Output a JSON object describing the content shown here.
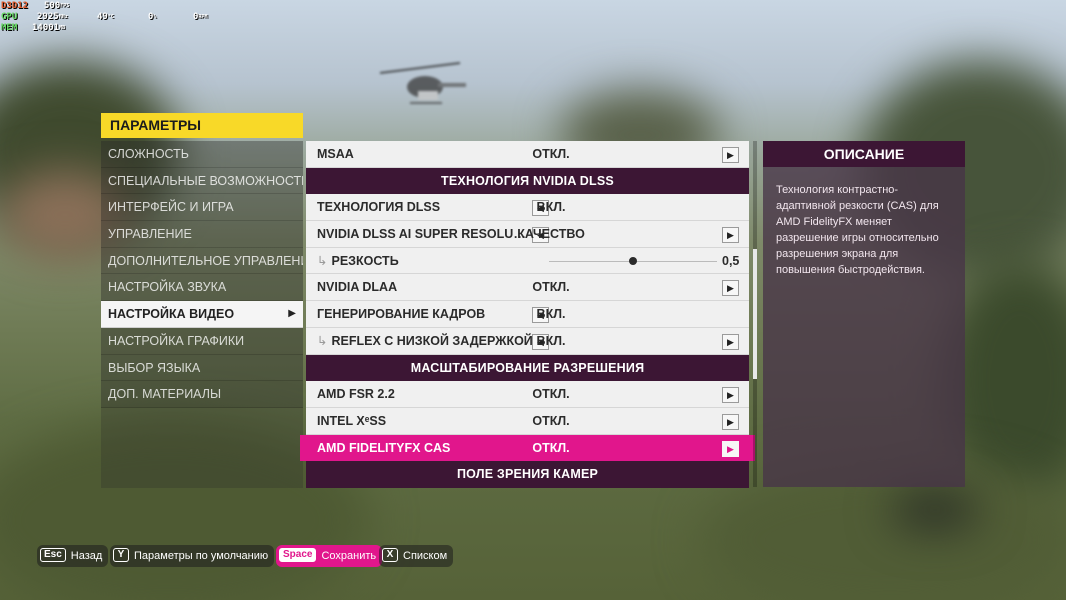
{
  "perf": {
    "labels": [
      "D3D12",
      "GPU",
      "MEM"
    ],
    "values": [
      "500",
      "2925",
      "14001"
    ],
    "units": [
      "FPS",
      "MHz",
      "MB"
    ],
    "temps": [
      {
        "value": "49",
        "unit": "°C"
      },
      {
        "value": "0",
        "unit": "%"
      },
      {
        "value": "0",
        "unit": "RPM"
      }
    ]
  },
  "menu": {
    "header": "ПАРАМЕТРЫ",
    "items": [
      {
        "label": "СЛОЖНОСТЬ"
      },
      {
        "label": "СПЕЦИАЛЬНЫЕ ВОЗМОЖНОСТИ"
      },
      {
        "label": "ИНТЕРФЕЙС И ИГРА"
      },
      {
        "label": "УПРАВЛЕНИЕ"
      },
      {
        "label": "ДОПОЛНИТЕЛЬНОЕ УПРАВЛЕНИЕ"
      },
      {
        "label": "НАСТРОЙКА ЗВУКА"
      },
      {
        "label": "НАСТРОЙКА ВИДЕО"
      },
      {
        "label": "НАСТРОЙКА ГРАФИКИ"
      },
      {
        "label": "ВЫБОР ЯЗЫКА"
      },
      {
        "label": "ДОП. МАТЕРИАЛЫ"
      }
    ],
    "active_index": 6
  },
  "settings": {
    "msaa": {
      "label": "MSAA",
      "value": "ОТКЛ."
    },
    "section_dlss": "ТЕХНОЛОГИЯ NVIDIA DLSS",
    "dlss": {
      "label": "ТЕХНОЛОГИЯ DLSS",
      "value": "ВКЛ."
    },
    "dlss_sr": {
      "label": "NVIDIA DLSS AI SUPER RESOLU…",
      "value": "КАЧЕСТВО"
    },
    "sharpness": {
      "prefix": "↳",
      "label": "РЕЗКОСТЬ",
      "value": "0,5",
      "level": 0.5
    },
    "dlaa": {
      "label": "NVIDIA DLAA",
      "value": "ОТКЛ."
    },
    "framegen": {
      "label": "ГЕНЕРИРОВАНИЕ КАДРОВ",
      "value": "ВКЛ."
    },
    "reflex": {
      "prefix": "↳",
      "label": "REFLEX С НИЗКОЙ ЗАДЕРЖКОЙ",
      "value": "ВКЛ."
    },
    "section_scaling": "МАСШТАБИРОВАНИЕ РАЗРЕШЕНИЯ",
    "fsr": {
      "label": "AMD FSR 2.2",
      "value": "ОТКЛ."
    },
    "xess": {
      "label": "INTEL XᵉSS",
      "value": "ОТКЛ."
    },
    "cas": {
      "label": "AMD FIDELITYFX CAS",
      "value": "ОТКЛ."
    },
    "section_fov": "ПОЛЕ ЗРЕНИЯ КАМЕР"
  },
  "description": {
    "title": "ОПИСАНИЕ",
    "text": "Технология контрастно-адаптивной резкости (CAS) для AMD FidelityFX меняет разрешение игры относительно разрешения экрана для повышения быстродействия."
  },
  "hints": [
    {
      "key": "Esc",
      "label": "Назад"
    },
    {
      "key": "Y",
      "label": "Параметры по умолчанию"
    },
    {
      "key": "Space",
      "label": "Сохранить"
    },
    {
      "key": "X",
      "label": "Списком"
    }
  ],
  "icons": {
    "arrow_left": "arrow-left-icon",
    "arrow_right": "arrow-right-icon",
    "accent": "#e1168c",
    "header_yellow": "#f8d928",
    "section_purple": "#3c1634"
  }
}
